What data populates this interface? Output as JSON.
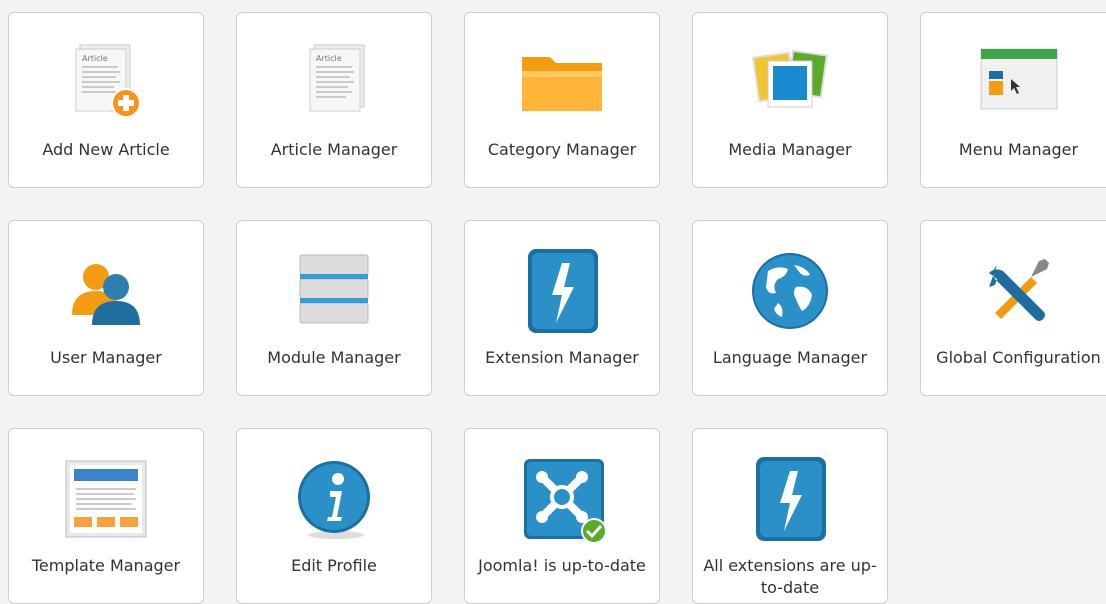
{
  "tiles": [
    {
      "label": "Add New Article",
      "icon": "add-article-icon"
    },
    {
      "label": "Article Manager",
      "icon": "article-icon"
    },
    {
      "label": "Category Manager",
      "icon": "folder-icon"
    },
    {
      "label": "Media Manager",
      "icon": "media-icon"
    },
    {
      "label": "Menu Manager",
      "icon": "menu-icon"
    },
    {
      "label": "User Manager",
      "icon": "users-icon"
    },
    {
      "label": "Module Manager",
      "icon": "module-icon"
    },
    {
      "label": "Extension Manager",
      "icon": "extension-icon"
    },
    {
      "label": "Language Manager",
      "icon": "globe-icon"
    },
    {
      "label": "Global Configuration",
      "icon": "tools-icon"
    },
    {
      "label": "Template Manager",
      "icon": "template-icon"
    },
    {
      "label": "Edit Profile",
      "icon": "info-icon"
    },
    {
      "label": "Joomla! is up-to-date",
      "icon": "joomla-icon"
    },
    {
      "label": "All extensions are up-to-date",
      "icon": "extension-update-icon"
    }
  ],
  "icons": {
    "article_title": "Article"
  },
  "colors": {
    "tile_bg": "#ffffff",
    "tile_border": "#cfcfcf",
    "page_bg": "#f3f3f3",
    "orange": "#f7941d",
    "blue": "#1a6fa3",
    "green": "#5aaa2c"
  }
}
